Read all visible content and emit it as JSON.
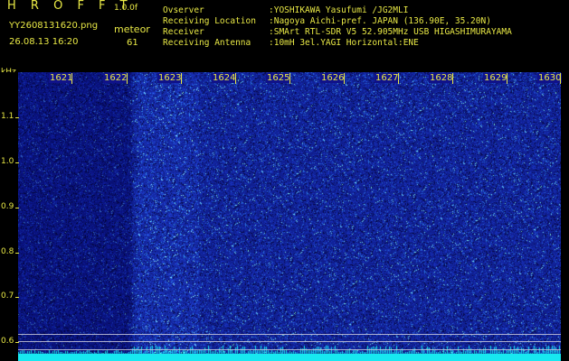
{
  "header": {
    "app_title": "H R O F F T",
    "app_version": "1.0.0f",
    "file_name": "YY2608131620.png",
    "mode_label": "meteor",
    "date_time": "26.08.13 16:20",
    "count_value": "61",
    "info": [
      {
        "key": "Ovserver",
        "value": ":YOSHIKAWA Yasufumi /JG2MLI"
      },
      {
        "key": "Receiving Location",
        "value": ":Nagoya Aichi-pref. JAPAN (136.90E, 35.20N)"
      },
      {
        "key": "Receiver",
        "value": ":SMArt RTL-SDR V5 52.905MHz USB HIGASHIMURAYAMA"
      },
      {
        "key": "Receiving Antenna",
        "value": ":10mH 3el.YAGI Horizontal:ENE"
      }
    ]
  },
  "axis": {
    "unit_label": "kHz",
    "y_ticks": [
      "1.1",
      "1.0",
      "0.9",
      "0.8",
      "0.7",
      "0.6"
    ],
    "x_ticks": [
      "1621",
      "1622",
      "1623",
      "1624",
      "1625",
      "1626",
      "1627",
      "1628",
      "1629",
      "1630"
    ]
  },
  "colors": {
    "text": "#e8e845",
    "background": "#10128a",
    "signal": "#17e8f0"
  }
}
